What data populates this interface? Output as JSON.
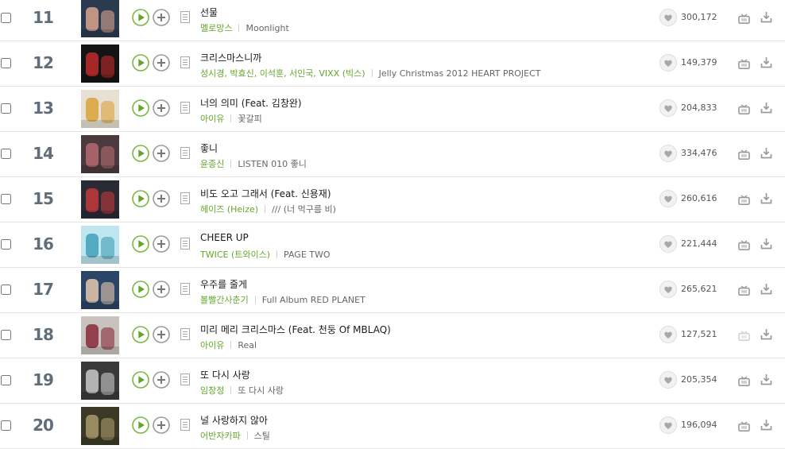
{
  "colors": {
    "accent_green": "#63a72a",
    "rank_gray": "#5f6e7a",
    "icon_gray": "#9a9a9a",
    "icon_disabled": "#d2d2d2",
    "divider": "#e4e4e4"
  },
  "icons": {
    "play": "play-circle-icon",
    "add": "plus-circle-icon",
    "lyrics": "document-icon",
    "like": "heart-icon",
    "mv": "tv-icon",
    "download": "download-icon"
  },
  "songs": [
    {
      "rank": "11",
      "title": "선물",
      "artist": "멜로망스",
      "album": "Moonlight",
      "likes": "300,172",
      "mv_enabled": true,
      "thumb": [
        "#2b3b4f",
        "#d9a58d"
      ]
    },
    {
      "rank": "12",
      "title": "크리스마스니까",
      "artist": "성시경, 박효신, 이석훈, 서인국, VIXX (빅스)",
      "album": "Jelly Christmas 2012 HEART PROJECT",
      "likes": "149,379",
      "mv_enabled": true,
      "thumb": [
        "#141414",
        "#c02a2a"
      ]
    },
    {
      "rank": "13",
      "title": "너의 의미 (Feat. 김창완)",
      "artist": "아이유",
      "album": "꽃갈피",
      "likes": "204,833",
      "mv_enabled": true,
      "thumb": [
        "#e8e0d2",
        "#d9a23a"
      ]
    },
    {
      "rank": "14",
      "title": "좋니",
      "artist": "윤종신",
      "album": "LISTEN 010 좋니",
      "likes": "334,476",
      "mv_enabled": true,
      "thumb": [
        "#4a3a3e",
        "#b56a70"
      ]
    },
    {
      "rank": "15",
      "title": "비도 오고 그래서 (Feat. 신용재)",
      "artist": "헤이즈 (Heize)",
      "album": "/// (너 먹구름 비)",
      "likes": "260,616",
      "mv_enabled": true,
      "thumb": [
        "#2a2a35",
        "#c23a3a"
      ]
    },
    {
      "rank": "16",
      "title": "CHEER UP",
      "artist": "TWICE (트와이스)",
      "album": "PAGE TWO",
      "likes": "221,444",
      "mv_enabled": true,
      "thumb": [
        "#bfe6ee",
        "#3f9fb8"
      ]
    },
    {
      "rank": "17",
      "title": "우주를 줄게",
      "artist": "볼빨간사춘기",
      "album": "Full Album RED PLANET",
      "likes": "265,621",
      "mv_enabled": true,
      "thumb": [
        "#2b4566",
        "#e6c9b0"
      ]
    },
    {
      "rank": "18",
      "title": "미리 메리 크리스마스 (Feat. 천둥 Of MBLAQ)",
      "artist": "아이유",
      "album": "Real",
      "likes": "127,521",
      "mv_enabled": false,
      "thumb": [
        "#c8c3be",
        "#8a2a3a"
      ]
    },
    {
      "rank": "19",
      "title": "또 다시 사랑",
      "artist": "임창정",
      "album": "또 다시 사랑",
      "likes": "205,354",
      "mv_enabled": true,
      "thumb": [
        "#3a3a3a",
        "#c9c9c9"
      ]
    },
    {
      "rank": "20",
      "title": "널 사랑하지 않아",
      "artist": "어반자카파",
      "album": "스틸",
      "likes": "196,094",
      "mv_enabled": true,
      "thumb": [
        "#3c3a26",
        "#a89a6a"
      ]
    }
  ]
}
